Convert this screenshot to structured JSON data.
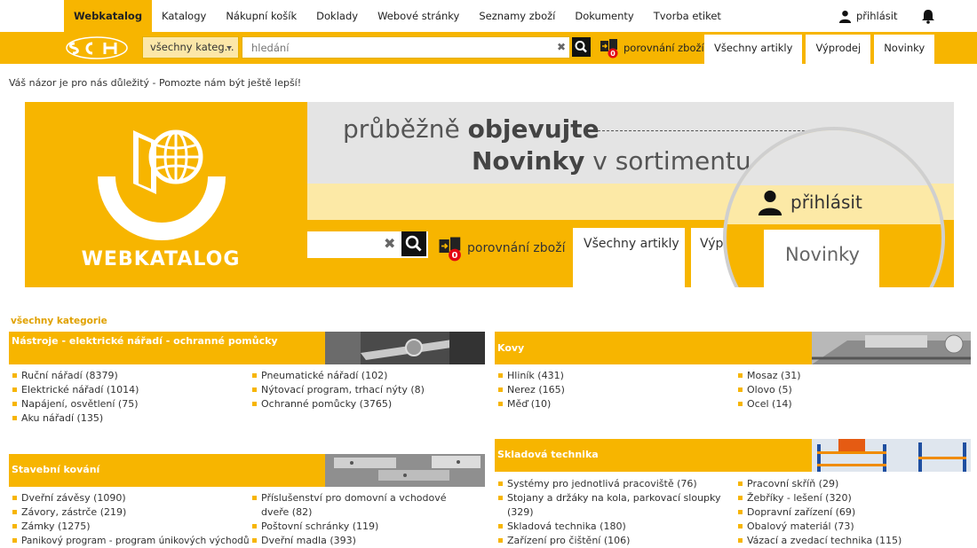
{
  "nav": {
    "items": [
      {
        "label": "Webkatalog",
        "active": true
      },
      {
        "label": "Katalogy"
      },
      {
        "label": "Nákupní košík"
      },
      {
        "label": "Doklady"
      },
      {
        "label": "Webové stránky"
      },
      {
        "label": "Seznamy zboží"
      },
      {
        "label": "Dokumenty"
      },
      {
        "label": "Tvorba etiket"
      }
    ],
    "login_label": "přihlásit"
  },
  "search": {
    "category_value": "všechny kateg...",
    "placeholder": "hledání",
    "clear_glyph": "✖",
    "compare_label": "porovnání zboží",
    "compare_count": "0"
  },
  "tabs": [
    "Všechny artikly",
    "Výprodej",
    "Novinky"
  ],
  "feedback": "Váš názor je pro nás důležitý - Pomozte nám být ještě lepší!",
  "banner": {
    "wordmark": "WEBKATALOG",
    "line1_normal": "průběžně ",
    "line1_bold": "objevujte",
    "line2_bold": "Novinky",
    "line2_normal": " v sortimentu",
    "compare_label": "porovnání zboží",
    "compare_count": "0",
    "clear_glyph": "✖",
    "tab1": "Všechny artikly",
    "tab2": "Výpr",
    "mag_login": "přihlásit",
    "mag_tab": "Novinky"
  },
  "all_categories": "všechny kategorie",
  "categories": {
    "tools": {
      "title": "Nástroje - elektrické nářadí - ochranné pomůcky",
      "col1": [
        "Ruční nářadí (8379)",
        "Elektrické nářadí (1014)",
        "Napájení, osvětlení (75)",
        "Aku nářadí (135)"
      ],
      "col2": [
        "Pneumatické nářadí (102)",
        "Nýtovací program, trhací nýty (8)",
        "Ochranné pomůcky (3765)"
      ]
    },
    "metals": {
      "title": "Kovy",
      "col1": [
        "Hliník (431)",
        "Nerez (165)",
        "Měď (10)"
      ],
      "col2": [
        "Mosaz (31)",
        "Olovo (5)",
        "Ocel (14)"
      ]
    },
    "hardware": {
      "title": "Stavební kování",
      "col1": [
        "Dveřní závěsy (1090)",
        "Závory, zástrče (219)",
        "Zámky (1275)",
        "Panikový program - program únikových východů"
      ],
      "col2": [
        "Příslušenství pro domovní a vchodové dveře (82)",
        "Poštovní schránky (119)",
        "Dveřní madla (393)"
      ]
    },
    "storage": {
      "title": "Skladová technika",
      "col1": [
        "Systémy pro jednotlivá pracoviště (76)",
        "Stojany a držáky na kola, parkovací sloupky (329)",
        "Skladová technika (180)",
        "Zařízení pro čištění (106)"
      ],
      "col2": [
        "Pracovní skříň (29)",
        "Žebříky - lešení (320)",
        "Dopravní zařízení (69)",
        "Obalový materiál (73)",
        "Vázací a zvedací technika (115)"
      ]
    }
  }
}
